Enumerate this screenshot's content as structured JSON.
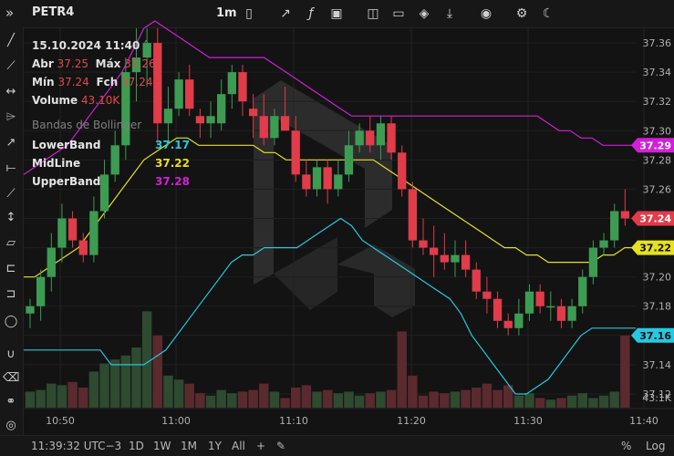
{
  "toolbar": {
    "symbol": "PETR4",
    "interval": "1m",
    "icons": [
      "expand-icon",
      "candlestick-icon",
      "indicators-icon",
      "function-icon",
      "image-icon",
      "layout-icon",
      "folder-icon",
      "layers-icon",
      "download-icon",
      "camera-icon",
      "gear-icon",
      "moon-icon"
    ]
  },
  "legend": {
    "datetime": "15.10.2024 11:40",
    "open_label": "Abr",
    "open": "37.25",
    "high_label": "Máx",
    "high": "37.26",
    "low_label": "Mín",
    "low": "37.24",
    "close_label": "Fch",
    "close": "37.24",
    "volume_label": "Volume",
    "volume": "43.10K"
  },
  "bollinger": {
    "title": "Bandas de Bollinger",
    "lower_label": "LowerBand",
    "lower_value": "37.17",
    "mid_label": "MidLine",
    "mid_value": "37.22",
    "upper_label": "UpperBand",
    "upper_value": "37.28"
  },
  "bottombar": {
    "time": "11:39:32 UTC−3",
    "ranges": [
      "1D",
      "1W",
      "1M",
      "1Y",
      "All"
    ],
    "percent": "%",
    "log": "Log"
  },
  "colors": {
    "up": "#3d9c52",
    "down": "#e03c4a",
    "upper": "#d020d8",
    "mid": "#e6e020",
    "lower": "#28c8e0",
    "volume_up": "#2e4a30",
    "volume_down": "#5a2a2e",
    "price_badge": "#e03c4a"
  },
  "chart_data": {
    "type": "candlestick",
    "y_ticks": [
      "37.36",
      "37.34",
      "37.32",
      "37.30",
      "37.28",
      "37.26",
      "37.24",
      "37.22",
      "37.20",
      "37.18",
      "37.16",
      "37.14",
      "37.12"
    ],
    "x_ticks": [
      "10:50",
      "11:00",
      "11:10",
      "11:20",
      "11:30",
      "11:40"
    ],
    "ylim": [
      37.11,
      37.37
    ],
    "price_badges": {
      "upper": "37.29",
      "close": "37.24",
      "mid": "37.22",
      "lower": "37.16"
    },
    "volume_label": "43.1K",
    "candles": [
      {
        "o": 37.175,
        "h": 37.185,
        "l": 37.165,
        "c": 37.18,
        "v": 0.2
      },
      {
        "o": 37.18,
        "h": 37.205,
        "l": 37.17,
        "c": 37.2,
        "v": 0.22
      },
      {
        "o": 37.2,
        "h": 37.23,
        "l": 37.19,
        "c": 37.22,
        "v": 0.3
      },
      {
        "o": 37.22,
        "h": 37.25,
        "l": 37.21,
        "c": 37.24,
        "v": 0.28
      },
      {
        "o": 37.24,
        "h": 37.245,
        "l": 37.22,
        "c": 37.225,
        "v": 0.32
      },
      {
        "o": 37.225,
        "h": 37.23,
        "l": 37.21,
        "c": 37.215,
        "v": 0.25
      },
      {
        "o": 37.215,
        "h": 37.255,
        "l": 37.21,
        "c": 37.245,
        "v": 0.45
      },
      {
        "o": 37.245,
        "h": 37.28,
        "l": 37.24,
        "c": 37.27,
        "v": 0.55
      },
      {
        "o": 37.27,
        "h": 37.3,
        "l": 37.265,
        "c": 37.29,
        "v": 0.6
      },
      {
        "o": 37.29,
        "h": 37.35,
        "l": 37.28,
        "c": 37.34,
        "v": 0.65
      },
      {
        "o": 37.34,
        "h": 37.37,
        "l": 37.32,
        "c": 37.35,
        "v": 0.75
      },
      {
        "o": 37.35,
        "h": 37.37,
        "l": 37.33,
        "c": 37.36,
        "v": 1.2
      },
      {
        "o": 37.36,
        "h": 37.37,
        "l": 37.29,
        "c": 37.305,
        "v": 0.9
      },
      {
        "o": 37.305,
        "h": 37.33,
        "l": 37.29,
        "c": 37.315,
        "v": 0.4
      },
      {
        "o": 37.315,
        "h": 37.34,
        "l": 37.31,
        "c": 37.335,
        "v": 0.35
      },
      {
        "o": 37.335,
        "h": 37.345,
        "l": 37.31,
        "c": 37.315,
        "v": 0.3
      },
      {
        "o": 37.31,
        "h": 37.315,
        "l": 37.295,
        "c": 37.305,
        "v": 0.18
      },
      {
        "o": 37.305,
        "h": 37.32,
        "l": 37.295,
        "c": 37.31,
        "v": 0.15
      },
      {
        "o": 37.305,
        "h": 37.335,
        "l": 37.3,
        "c": 37.325,
        "v": 0.22
      },
      {
        "o": 37.325,
        "h": 37.345,
        "l": 37.315,
        "c": 37.34,
        "v": 0.18
      },
      {
        "o": 37.34,
        "h": 37.345,
        "l": 37.31,
        "c": 37.32,
        "v": 0.2
      },
      {
        "o": 37.315,
        "h": 37.325,
        "l": 37.295,
        "c": 37.31,
        "v": 0.22
      },
      {
        "o": 37.31,
        "h": 37.325,
        "l": 37.29,
        "c": 37.295,
        "v": 0.3
      },
      {
        "o": 37.295,
        "h": 37.315,
        "l": 37.29,
        "c": 37.31,
        "v": 0.2
      },
      {
        "o": 37.31,
        "h": 37.33,
        "l": 37.3,
        "c": 37.3,
        "v": 0.12
      },
      {
        "o": 37.3,
        "h": 37.31,
        "l": 37.265,
        "c": 37.27,
        "v": 0.25
      },
      {
        "o": 37.27,
        "h": 37.28,
        "l": 37.255,
        "c": 37.26,
        "v": 0.28
      },
      {
        "o": 37.26,
        "h": 37.28,
        "l": 37.255,
        "c": 37.275,
        "v": 0.2
      },
      {
        "o": 37.275,
        "h": 37.28,
        "l": 37.25,
        "c": 37.26,
        "v": 0.22
      },
      {
        "o": 37.26,
        "h": 37.28,
        "l": 37.255,
        "c": 37.27,
        "v": 0.18
      },
      {
        "o": 37.27,
        "h": 37.3,
        "l": 37.265,
        "c": 37.29,
        "v": 0.2
      },
      {
        "o": 37.29,
        "h": 37.305,
        "l": 37.285,
        "c": 37.3,
        "v": 0.15
      },
      {
        "o": 37.3,
        "h": 37.31,
        "l": 37.285,
        "c": 37.29,
        "v": 0.18
      },
      {
        "o": 37.29,
        "h": 37.31,
        "l": 37.28,
        "c": 37.305,
        "v": 0.2
      },
      {
        "o": 37.305,
        "h": 37.31,
        "l": 37.28,
        "c": 37.285,
        "v": 0.22
      },
      {
        "o": 37.285,
        "h": 37.29,
        "l": 37.255,
        "c": 37.26,
        "v": 0.95
      },
      {
        "o": 37.26,
        "h": 37.265,
        "l": 37.22,
        "c": 37.225,
        "v": 0.4
      },
      {
        "o": 37.225,
        "h": 37.24,
        "l": 37.215,
        "c": 37.22,
        "v": 0.15
      },
      {
        "o": 37.22,
        "h": 37.235,
        "l": 37.2,
        "c": 37.215,
        "v": 0.2
      },
      {
        "o": 37.215,
        "h": 37.23,
        "l": 37.205,
        "c": 37.21,
        "v": 0.18
      },
      {
        "o": 37.21,
        "h": 37.225,
        "l": 37.2,
        "c": 37.215,
        "v": 0.2
      },
      {
        "o": 37.215,
        "h": 37.225,
        "l": 37.2,
        "c": 37.205,
        "v": 0.22
      },
      {
        "o": 37.205,
        "h": 37.21,
        "l": 37.185,
        "c": 37.19,
        "v": 0.25
      },
      {
        "o": 37.19,
        "h": 37.2,
        "l": 37.175,
        "c": 37.185,
        "v": 0.3
      },
      {
        "o": 37.185,
        "h": 37.19,
        "l": 37.165,
        "c": 37.17,
        "v": 0.22
      },
      {
        "o": 37.17,
        "h": 37.175,
        "l": 37.16,
        "c": 37.165,
        "v": 0.28
      },
      {
        "o": 37.165,
        "h": 37.185,
        "l": 37.16,
        "c": 37.175,
        "v": 0.15
      },
      {
        "o": 37.175,
        "h": 37.195,
        "l": 37.17,
        "c": 37.19,
        "v": 0.18
      },
      {
        "o": 37.19,
        "h": 37.195,
        "l": 37.175,
        "c": 37.18,
        "v": 0.12
      },
      {
        "o": 37.18,
        "h": 37.19,
        "l": 37.17,
        "c": 37.18,
        "v": 0.1
      },
      {
        "o": 37.18,
        "h": 37.185,
        "l": 37.165,
        "c": 37.17,
        "v": 0.12
      },
      {
        "o": 37.17,
        "h": 37.185,
        "l": 37.165,
        "c": 37.18,
        "v": 0.15
      },
      {
        "o": 37.18,
        "h": 37.205,
        "l": 37.175,
        "c": 37.2,
        "v": 0.18
      },
      {
        "o": 37.2,
        "h": 37.225,
        "l": 37.195,
        "c": 37.22,
        "v": 0.12
      },
      {
        "o": 37.22,
        "h": 37.23,
        "l": 37.215,
        "c": 37.225,
        "v": 0.15
      },
      {
        "o": 37.225,
        "h": 37.25,
        "l": 37.22,
        "c": 37.245,
        "v": 0.2
      },
      {
        "o": 37.245,
        "h": 37.26,
        "l": 37.235,
        "c": 37.24,
        "v": 0.9
      }
    ],
    "bands": {
      "upper": [
        37.27,
        37.275,
        37.28,
        37.285,
        37.29,
        37.3,
        37.31,
        37.32,
        37.33,
        37.34,
        37.355,
        37.37,
        37.375,
        37.37,
        37.365,
        37.36,
        37.355,
        37.35,
        37.35,
        37.35,
        37.35,
        37.35,
        37.35,
        37.345,
        37.34,
        37.335,
        37.33,
        37.325,
        37.32,
        37.315,
        37.31,
        37.31,
        37.31,
        37.31,
        37.31,
        37.31,
        37.31,
        37.31,
        37.31,
        37.31,
        37.31,
        37.31,
        37.31,
        37.31,
        37.31,
        37.31,
        37.31,
        37.31,
        37.305,
        37.3,
        37.3,
        37.295,
        37.295,
        37.29,
        37.29,
        37.29,
        37.29
      ],
      "mid": [
        37.2,
        37.2,
        37.205,
        37.21,
        37.215,
        37.22,
        37.23,
        37.24,
        37.25,
        37.26,
        37.27,
        37.28,
        37.285,
        37.29,
        37.295,
        37.295,
        37.29,
        37.29,
        37.29,
        37.29,
        37.29,
        37.29,
        37.285,
        37.285,
        37.28,
        37.28,
        37.28,
        37.28,
        37.28,
        37.28,
        37.28,
        37.28,
        37.28,
        37.275,
        37.27,
        37.265,
        37.26,
        37.255,
        37.25,
        37.245,
        37.24,
        37.235,
        37.23,
        37.225,
        37.22,
        37.22,
        37.215,
        37.215,
        37.21,
        37.21,
        37.21,
        37.21,
        37.21,
        37.215,
        37.215,
        37.22,
        37.22
      ],
      "lower": [
        37.15,
        37.15,
        37.15,
        37.15,
        37.15,
        37.15,
        37.15,
        37.15,
        37.14,
        37.14,
        37.14,
        37.14,
        37.145,
        37.15,
        37.16,
        37.17,
        37.18,
        37.19,
        37.2,
        37.21,
        37.215,
        37.215,
        37.22,
        37.22,
        37.22,
        37.22,
        37.225,
        37.23,
        37.235,
        37.24,
        37.235,
        37.225,
        37.22,
        37.215,
        37.21,
        37.205,
        37.2,
        37.195,
        37.19,
        37.185,
        37.175,
        37.16,
        37.15,
        37.14,
        37.13,
        37.12,
        37.12,
        37.125,
        37.13,
        37.14,
        37.15,
        37.16,
        37.165,
        37.165,
        37.165,
        37.165,
        37.165
      ]
    }
  }
}
